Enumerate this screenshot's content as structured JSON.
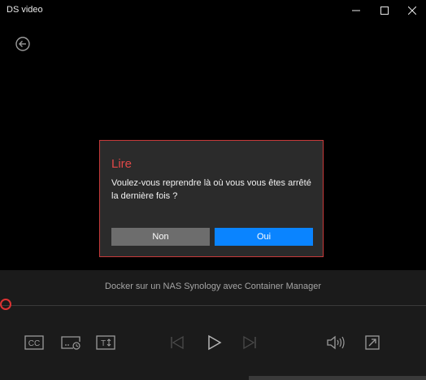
{
  "window": {
    "title": "DS video",
    "controls": [
      "minimize-icon",
      "maximize-icon",
      "close-icon"
    ]
  },
  "navigation": {
    "back_icon": "arrow-left-circle-icon"
  },
  "dialog": {
    "title": "Lire",
    "message": "Voulez-vous reprendre là où vous vous êtes arrêté la dernière fois ?",
    "no_label": "Non",
    "yes_label": "Oui",
    "accent_color": "#e04848",
    "primary_color": "#0a84ff"
  },
  "player": {
    "video_title": "Docker sur un NAS Synology avec Container Manager",
    "progress": 0.0,
    "controls": [
      "closed-captions-icon",
      "playback-timer-icon",
      "text-size-icon",
      "previous-icon",
      "play-icon",
      "next-icon",
      "volume-icon",
      "fullscreen-icon"
    ]
  }
}
